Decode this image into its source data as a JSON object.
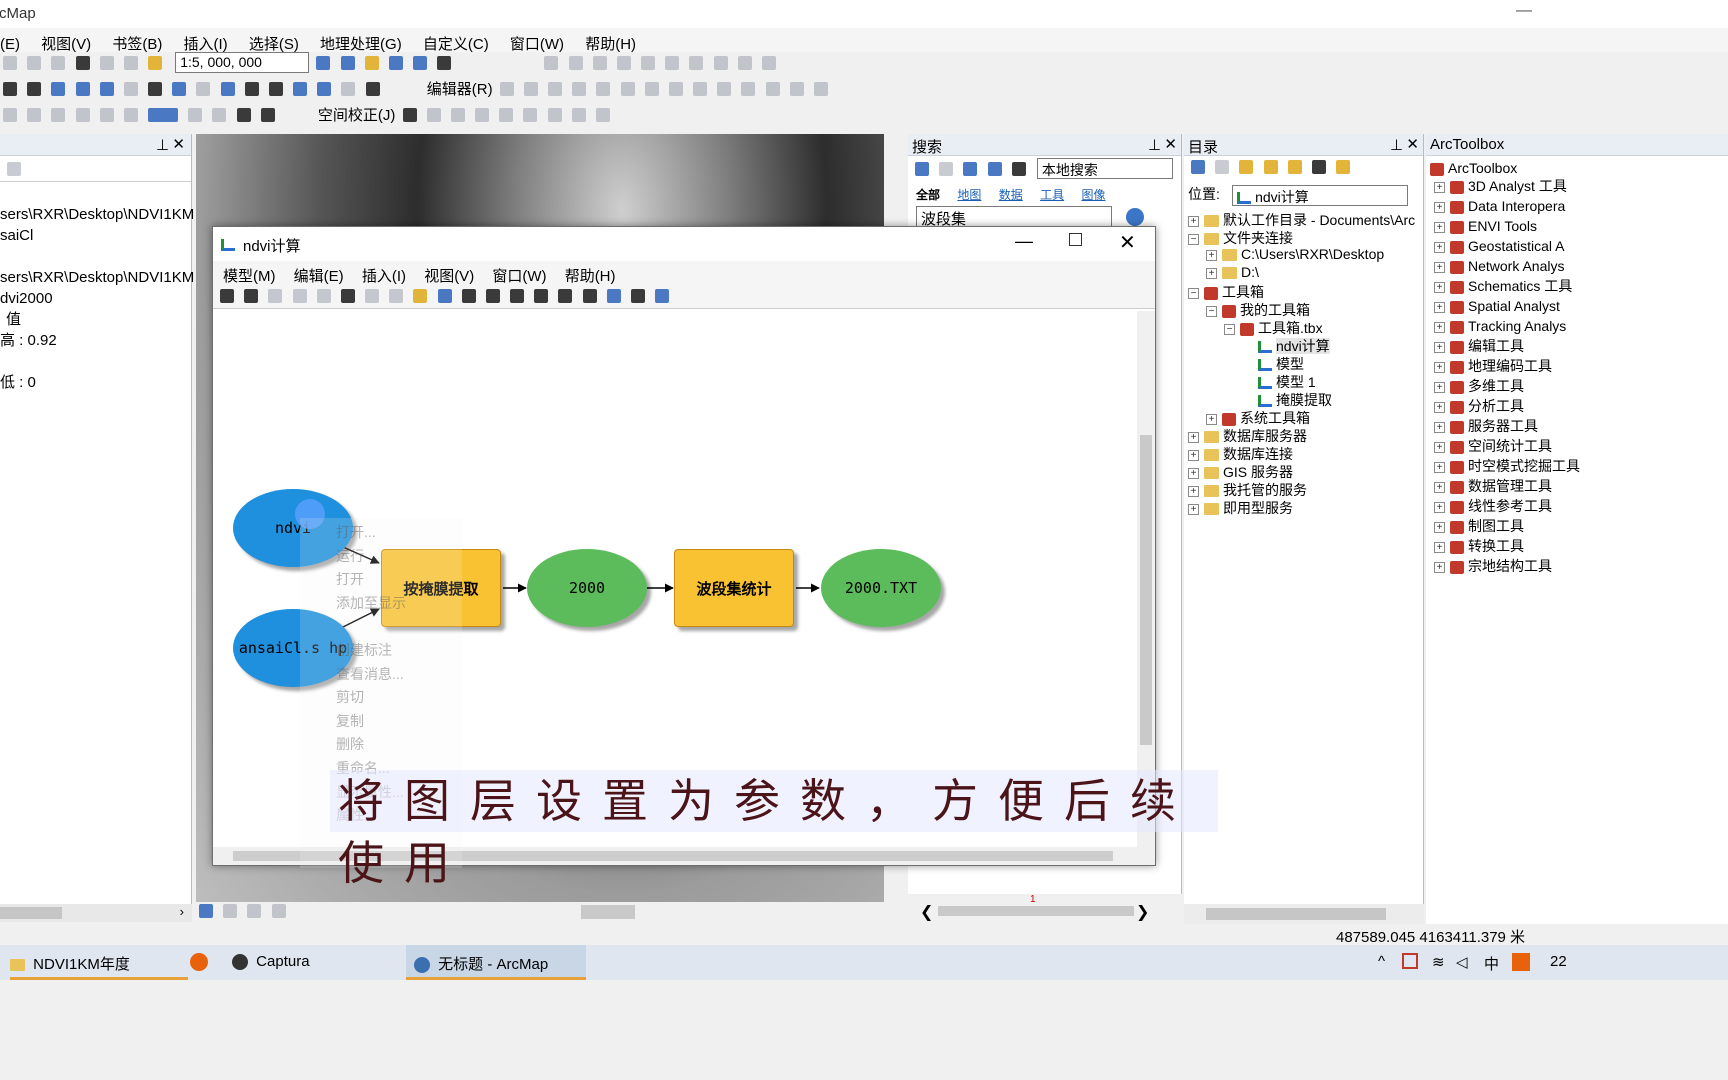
{
  "app": {
    "title": "rcMap"
  },
  "menubar": [
    "(E)",
    "视图(V)",
    "书签(B)",
    "插入(I)",
    "选择(S)",
    "地理处理(G)",
    "自定义(C)",
    "窗口(W)",
    "帮助(H)"
  ],
  "toolbar": {
    "scale_value": "1:5, 000, 000",
    "editor_label": "编辑器(R)",
    "spatial_adjust_label": "空间校正(J)"
  },
  "toc": {
    "lines": [
      "sers\\RXR\\Desktop\\NDVI1KM",
      "saiCl",
      "sers\\RXR\\Desktop\\NDVI1KM",
      "dvi2000",
      "值",
      "高 : 0.92",
      "低 : 0"
    ]
  },
  "model_window": {
    "title": "ndvi计算",
    "menu": [
      "模型(M)",
      "编辑(E)",
      "插入(I)",
      "视图(V)",
      "窗口(W)",
      "帮助(H)"
    ],
    "nodes": {
      "ndvi": "ndvi",
      "ansai": "ansaiCl.s hp",
      "mask": "按掩膜提取",
      "y2000": "2000",
      "bandstat": "波段集统计",
      "txt": "2000.TXT"
    },
    "context_menu": [
      "打开...",
      "运行",
      "打开",
      "添加至显示",
      "",
      "创建标注",
      "查看消息...",
      "剪切",
      "复制",
      "删除",
      "重命名...",
      "显示属性...",
      "属性..."
    ]
  },
  "search_panel": {
    "title": "搜索",
    "scope": "本地搜索",
    "tabs": [
      "全部",
      "地图",
      "数据",
      "工具",
      "图像"
    ],
    "query": "波段集",
    "page": "1"
  },
  "catalog_panel": {
    "title": "目录",
    "location_label": "位置:",
    "location_value": "ndvi计算",
    "tree": [
      "默认工作目录 - Documents\\Arc",
      "文件夹连接",
      "C:\\Users\\RXR\\Desktop",
      "D:\\",
      "工具箱",
      "我的工具箱",
      "工具箱.tbx",
      "ndvi计算",
      "模型",
      "模型 1",
      "掩膜提取",
      "系统工具箱",
      "数据库服务器",
      "数据库连接",
      "GIS 服务器",
      "我托管的服务",
      "即用型服务"
    ]
  },
  "arctoolbox": {
    "title": "ArcToolbox",
    "root": "ArcToolbox",
    "items": [
      "3D Analyst 工具",
      "Data Interopera",
      "ENVI Tools",
      "Geostatistical A",
      "Network Analys",
      "Schematics 工具",
      "Spatial Analyst",
      "Tracking Analys",
      "编辑工具",
      "地理编码工具",
      "多维工具",
      "分析工具",
      "服务器工具",
      "空间统计工具",
      "时空模式挖掘工具",
      "数据管理工具",
      "线性参考工具",
      "制图工具",
      "转换工具",
      "宗地结构工具"
    ]
  },
  "subtitle": "将图层设置为参数，方便后续使用",
  "status": {
    "coords": "487589.045 4163411.379 米"
  },
  "taskbar": {
    "items": [
      "NDVI1KM年度",
      "Captura",
      "无标题 - ArcMap"
    ],
    "time": "22"
  }
}
